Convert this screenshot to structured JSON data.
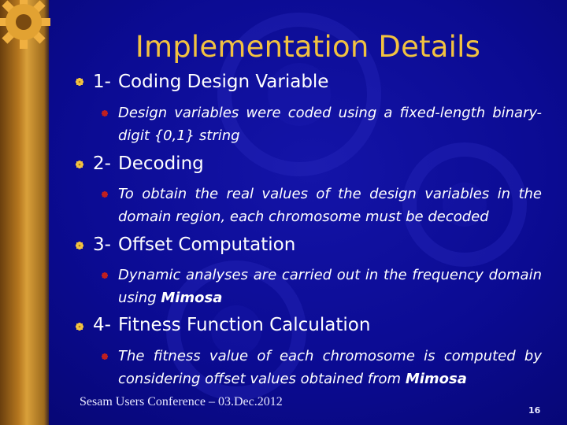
{
  "slide": {
    "title": "Implementation Details",
    "sections": [
      {
        "number": "1-",
        "heading": "Coding Design Variable",
        "detail": [
          {
            "text": "Design variables were coded using a fixed-length binary-digit {0,1} string",
            "bold": false
          }
        ]
      },
      {
        "number": "2-",
        "heading": "Decoding",
        "detail": [
          {
            "text": "To obtain the real values of the design variables in the domain region, each chromosome must be decoded",
            "bold": false
          }
        ]
      },
      {
        "number": "3-",
        "heading": "Offset Computation",
        "detail": [
          {
            "text": "Dynamic analyses are carried out in the frequency domain using ",
            "bold": false
          },
          {
            "text": "Mimosa",
            "bold": true
          }
        ]
      },
      {
        "number": "4-",
        "heading": "Fitness Function Calculation",
        "detail": [
          {
            "text": "The fitness value of each chromosome is computed by considering offset values obtained from ",
            "bold": false
          },
          {
            "text": "Mimosa",
            "bold": true
          }
        ]
      }
    ],
    "footer": "Sesam Users Conference – 03.Dec.2012",
    "page_number": "16"
  },
  "colors": {
    "background": "#0b0b92",
    "title": "#f2c240",
    "text": "#ffffff",
    "bullet": "#f2c240",
    "strip": "#b5771f"
  },
  "icons": {
    "bullet": "square-flower-bullet-icon",
    "gear": "gear-icon"
  }
}
